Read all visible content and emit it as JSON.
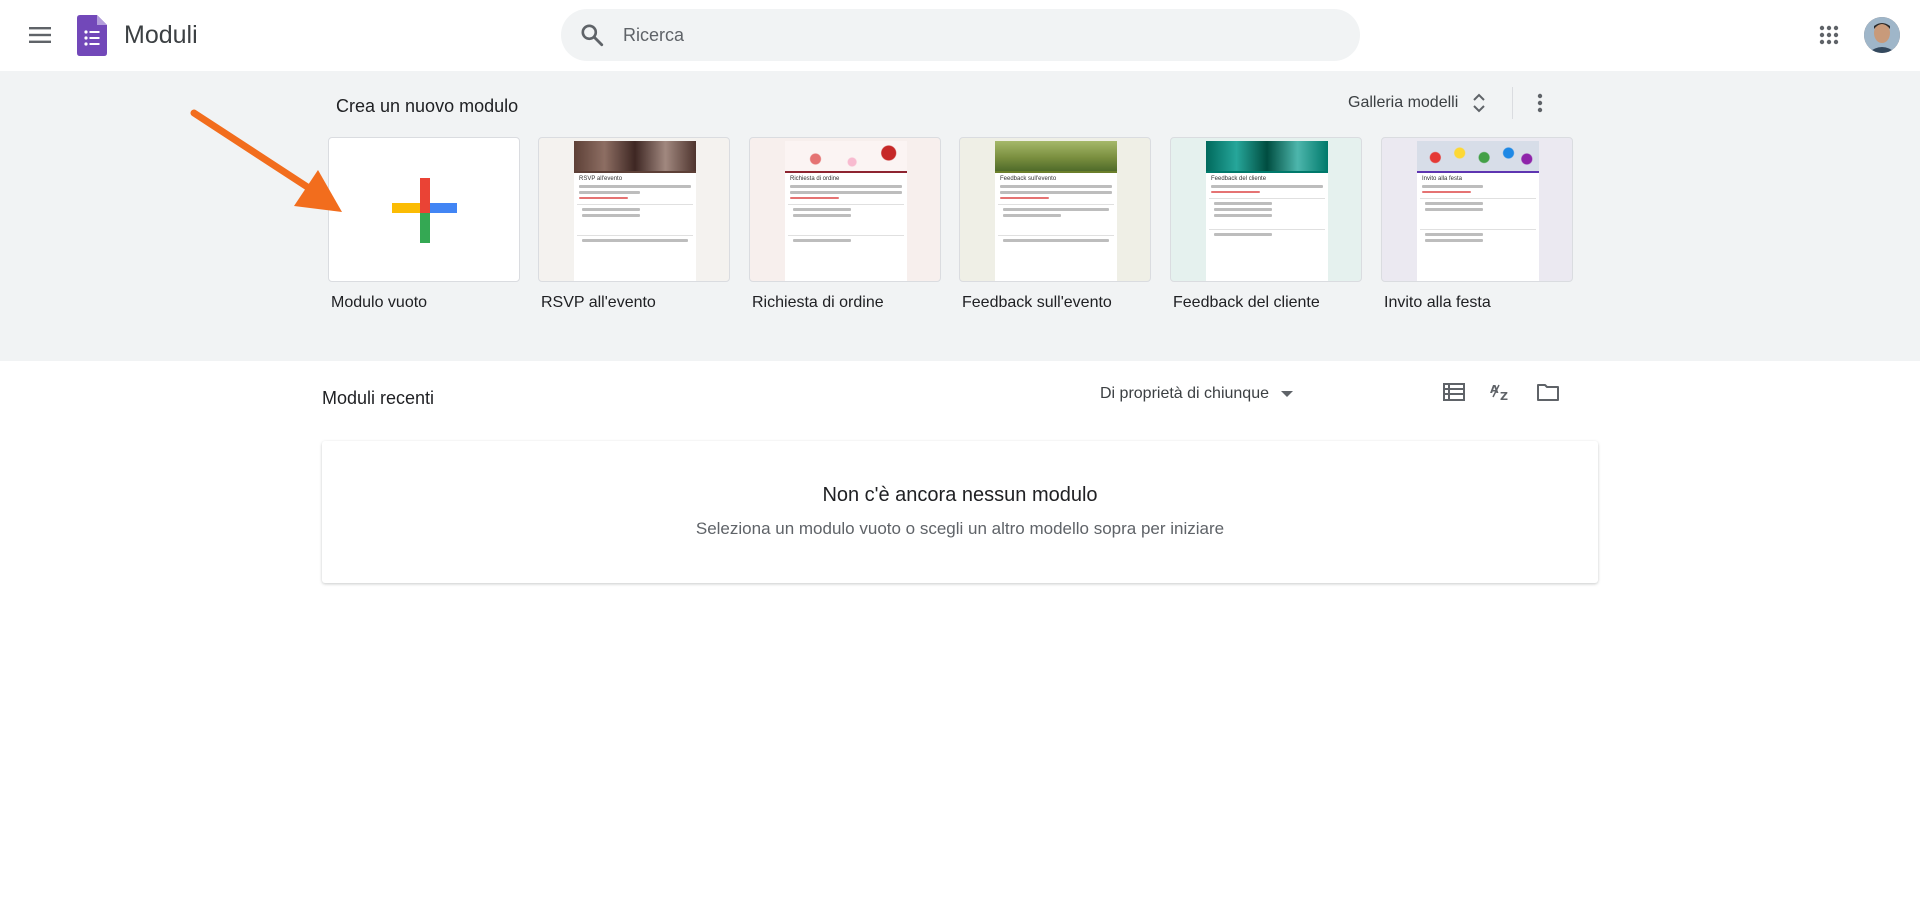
{
  "app": {
    "title": "Moduli",
    "brand_color": "#7248b9"
  },
  "search": {
    "placeholder": "Ricerca"
  },
  "templates_section": {
    "title": "Crea un nuovo modulo",
    "gallery_label": "Galleria modelli",
    "items": [
      {
        "label": "Modulo vuoto",
        "thumb_title": ""
      },
      {
        "label": "RSVP all'evento",
        "thumb_title": "RSVP all'evento"
      },
      {
        "label": "Richiesta di ordine",
        "thumb_title": "Richiesta di ordine"
      },
      {
        "label": "Feedback sull'evento",
        "thumb_title": "Feedback sull'evento"
      },
      {
        "label": "Feedback del cliente",
        "thumb_title": "Feedback del cliente"
      },
      {
        "label": "Invito alla festa",
        "thumb_title": "Invito alla festa"
      }
    ]
  },
  "recent": {
    "title": "Moduli recenti",
    "owner_filter": "Di proprietà di chiunque",
    "empty_title": "Non c'è ancora nessun modulo",
    "empty_subtitle": "Seleziona un modulo vuoto o scegli un altro modello sopra per iniziare"
  },
  "colors": {
    "band_bg": "#f1f3f4",
    "arrow": "#f26d1d",
    "plus_red": "#ea4335",
    "plus_blue": "#4285f4",
    "plus_green": "#34a853",
    "plus_yellow": "#fbbc04"
  }
}
